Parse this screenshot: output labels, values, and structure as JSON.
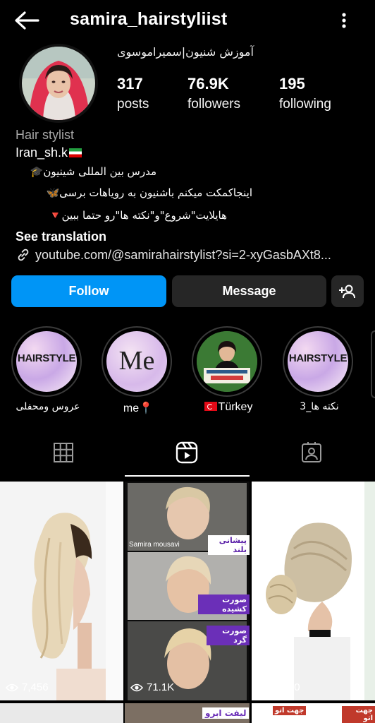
{
  "header": {
    "username": "samira_hairstyliist"
  },
  "profile": {
    "display_name": "آموزش شنیون|سمیراموسوی",
    "stats": [
      {
        "value": "317",
        "label": "posts"
      },
      {
        "value": "76.9K",
        "label": "followers"
      },
      {
        "value": "195",
        "label": "following"
      }
    ],
    "category": "Hair stylist",
    "bio_line1": "Iran_sh.k",
    "bio_line2": "مدرس بین المللی شینیون",
    "bio_line3": "اینجاکمکت میکنم باشنیون به رویاهات برسی",
    "bio_line4": "هایلایت\"شروع\"و\"نکته ها\"رو حتما ببین",
    "see_translation": "See translation",
    "link": "youtube.com/@samirahairstylist?si=2-xyGasbAXt8..."
  },
  "actions": {
    "follow": "Follow",
    "message": "Message"
  },
  "highlights": [
    {
      "caption": "عروس ومحفلی",
      "cover_text": "HAIRSTYLE"
    },
    {
      "caption": "me",
      "cover_text": "Me"
    },
    {
      "caption": "Türkey",
      "cover_text": ""
    },
    {
      "caption": "نکته ها_3",
      "cover_text": "HAIRSTYLE"
    }
  ],
  "posts": [
    {
      "views": "7,456"
    },
    {
      "views": "71.1K",
      "overlay_texts": [
        "Samira mousavi",
        "پیشانی بلند",
        "صورت کشیده",
        "صورت گرد"
      ]
    },
    {
      "views": "7,560"
    }
  ],
  "row2_labels": [
    "لیفت ابرو",
    "جهت اتو",
    "جهت اتو"
  ],
  "colors": {
    "accent": "#0095f6",
    "background": "#000000",
    "button_dark": "#262626"
  }
}
